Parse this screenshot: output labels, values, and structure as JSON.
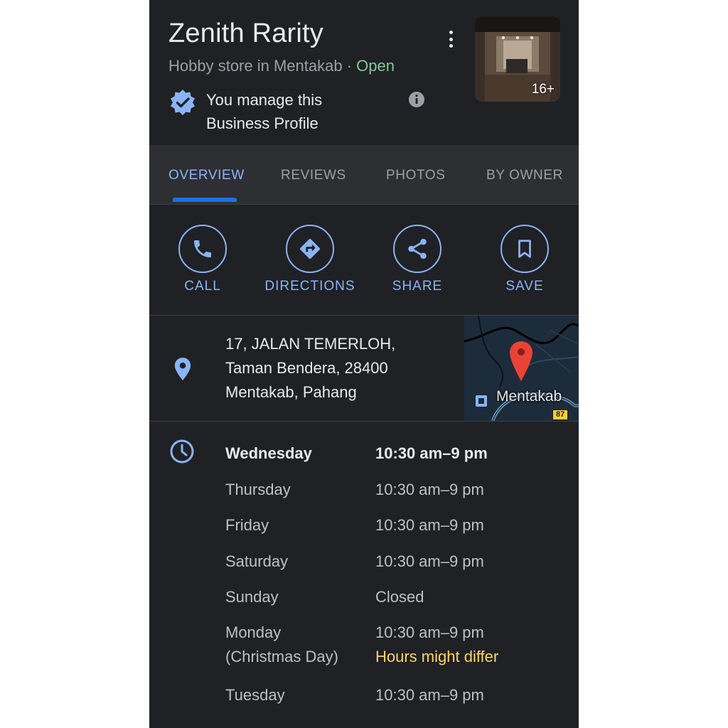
{
  "place": {
    "name": "Zenith Rarity",
    "category": "Hobby store in Mentakab",
    "separator": "·",
    "status": "Open",
    "photo_count": "16+",
    "manage_line1": "You manage this",
    "manage_line2": "Business Profile"
  },
  "tabs": [
    {
      "label": "OVERVIEW",
      "active": true
    },
    {
      "label": "REVIEWS",
      "active": false
    },
    {
      "label": "PHOTOS",
      "active": false
    },
    {
      "label": "BY OWNER",
      "active": false
    }
  ],
  "actions": [
    {
      "label": "CALL",
      "icon": "phone-icon"
    },
    {
      "label": "DIRECTIONS",
      "icon": "directions-icon"
    },
    {
      "label": "SHARE",
      "icon": "share-icon"
    },
    {
      "label": "SAVE",
      "icon": "bookmark-icon"
    }
  ],
  "address": {
    "line1": "17, JALAN TEMERLOH,",
    "line2": "Taman Bendera, 28400",
    "line3": "Mentakab, Pahang",
    "map_label": "Mentakab",
    "route_shield": "87"
  },
  "hours": [
    {
      "day": "Wednesday",
      "time": "10:30 am–9 pm",
      "today": true
    },
    {
      "day": "Thursday",
      "time": "10:30 am–9 pm"
    },
    {
      "day": "Friday",
      "time": "10:30 am–9 pm"
    },
    {
      "day": "Saturday",
      "time": "10:30 am–9 pm"
    },
    {
      "day": "Sunday",
      "time": "Closed"
    },
    {
      "day": "Monday",
      "day_note": "(Christmas Day)",
      "time": "10:30 am–9 pm",
      "note": "Hours might differ"
    },
    {
      "day": "Tuesday",
      "time": "10:30 am–9 pm"
    }
  ],
  "colors": {
    "background": "#202124",
    "accent": "#8ab4f8",
    "open": "#81c995",
    "warning": "#fdd663",
    "map_pin": "#ea4335"
  }
}
